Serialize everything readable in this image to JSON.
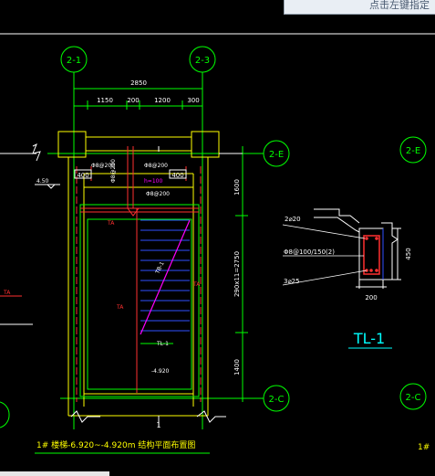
{
  "hint": {
    "text": "点击左键指定"
  },
  "axes": {
    "a21": "2-1",
    "a23": "2-3",
    "a2e": "2-E",
    "a2e_right": "2-E",
    "a2c": "2-C",
    "a2c_right": "2-C"
  },
  "dims": {
    "total": "2850",
    "d1150": "1150",
    "d200a": "200",
    "d1200": "1200",
    "d300": "300",
    "d1600": "1600",
    "dflight": "290x11=2750",
    "d1400": "1400"
  },
  "labels": {
    "opening_left": "400",
    "opening_right": "400",
    "rebar_a": "Φ8@200",
    "rebar_b": "Φ8@200",
    "rebar_c": "Φ8@200",
    "rebar_d": "Φ8@200",
    "tag_magenta": "h=100",
    "tag_ta_left": "TA",
    "tag_ta_mid": "TA",
    "tag_ta_right": "TA",
    "tag_ta_far": "TA",
    "elev": "4.50",
    "tl1_small": "TL-1",
    "level_small": "-4.920",
    "stair_tag": "TB-1",
    "section_mark": "1",
    "title": "1# 楼梯-6.920~-4.920m 结构平面布置图",
    "title_right": "1#"
  },
  "section": {
    "top_bar": "2⌀20",
    "stirrup": "Φ8@100/150(2)",
    "bottom_bar": "3⌀25",
    "width": "200",
    "height": "450",
    "title": "TL-1"
  },
  "colors": {
    "background": "#000000",
    "axis": "#00ff00",
    "wall": "#ffff00",
    "dim": "#00ffff",
    "red": "#ff3030",
    "blue": "#3050ff",
    "magenta": "#ff00ff",
    "white": "#ffffff"
  }
}
